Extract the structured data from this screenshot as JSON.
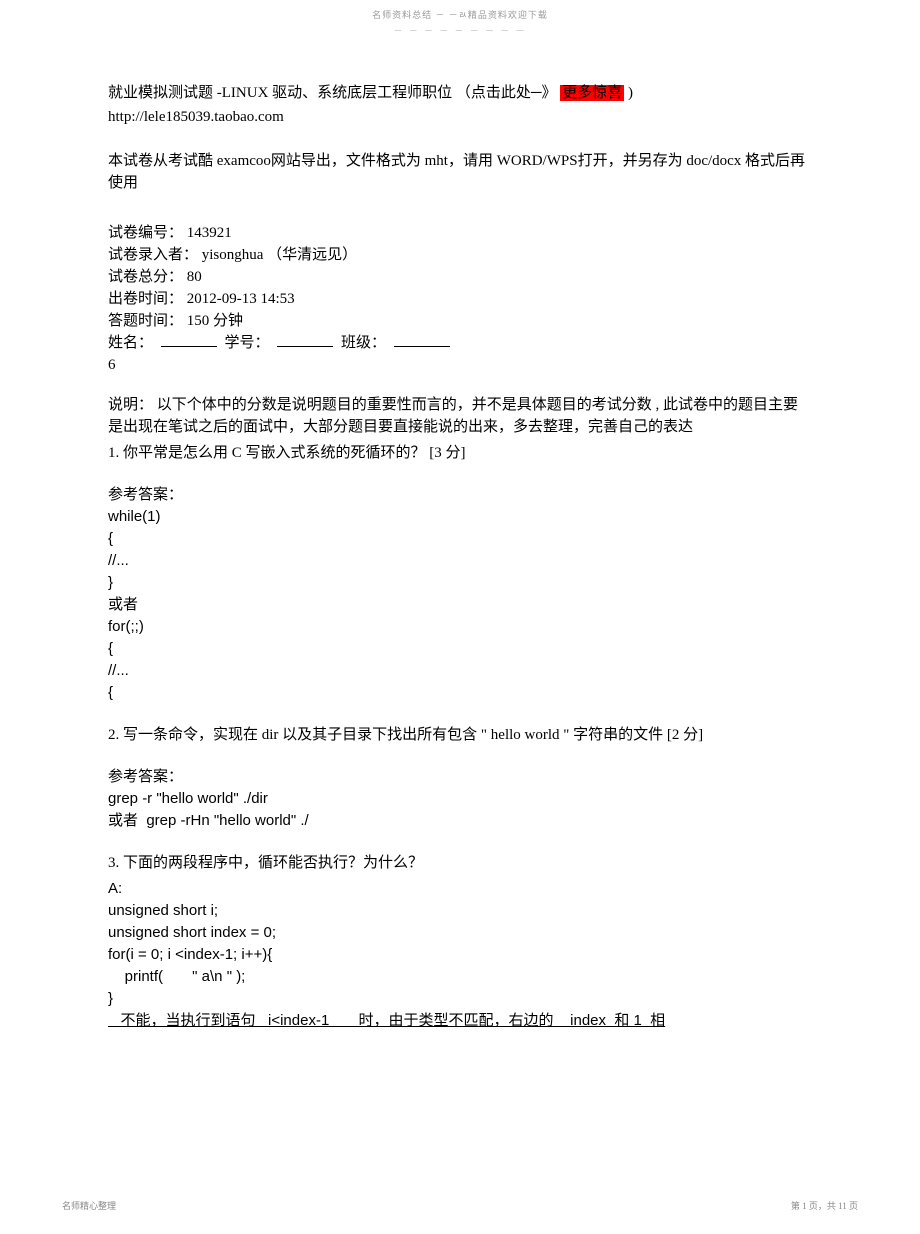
{
  "header": {
    "top_text": "名师资料总结   －  －ﾭ精品资料欢迎下载",
    "dashes": "－ － － － － － － － －"
  },
  "title": {
    "part1": "就业模拟测试题  -LINUX 驱动、系统底层工程师职位    （点击此处─》",
    "highlight": "更多惊喜",
    "part2": ")",
    "url": "http://lele185039.taobao.com"
  },
  "intro": "本试卷从考试酷   examcoo网站导出，文件格式为    mht，请用  WORD/WPS打开，并另存为  doc/docx  格式后再使用",
  "meta": {
    "paper_no_label": "试卷编号：",
    "paper_no": "143921",
    "author_label": "试卷录入者：",
    "author": "yisonghua  （华清远见）",
    "total_label": "试卷总分：",
    "total": "80",
    "issue_time_label": "出卷时间：",
    "issue_time": "2012-09-13 14:53",
    "answer_time_label": "答题时间：",
    "answer_time": "150 分钟",
    "name_label": "姓名：",
    "id_label": "学号：",
    "class_label": "班级：",
    "extra_six": " 6"
  },
  "notes": {
    "label": "说明：",
    "text": "以下个体中的分数是说明题目的重要性而言的，并不是具体题目的考试分数 , 此试卷中的题目主要是出现在笔试之后的面试中，大部分题目要直接能说的出来，多去整理，完善自己的表达"
  },
  "q1": {
    "text": "1. 你平常是怎么用   C 写嵌入式系统的死循环的？     [3   分]",
    "ans_label": "参考答案：",
    "lines": [
      "while(1)",
      "{",
      "//...",
      "}",
      "或者",
      "for(;;)",
      "{",
      "//...",
      "{"
    ]
  },
  "q2": {
    "text_a": "2. 写一条命令，实现在    dir   以及其子目录下找出所有包含 \"",
    "text_b": "hello world",
    "text_c": "    \" 字符串的文件 [2  分]",
    "ans_label": "参考答案：",
    "lines": [
      "grep -r \"hello world\" ./dir",
      "或者  grep -rHn \"hello world\" ./"
    ]
  },
  "q3": {
    "text": "3.  下面的两段程序中，循环能否执行？为什么？",
    "lines": [
      "A:",
      "unsigned short i;",
      "unsigned short index = 0;",
      "for(i = 0; i <index-1; i++){",
      "    printf(       \" a\\n \" );",
      "}"
    ],
    "underlined": "   不能，当执行到语句   i<index-1       时，由于类型不匹配，右边的    index  和 1  相"
  },
  "footer": {
    "left": "名师精心整理",
    "right": "第 1 页，共 11 页"
  }
}
